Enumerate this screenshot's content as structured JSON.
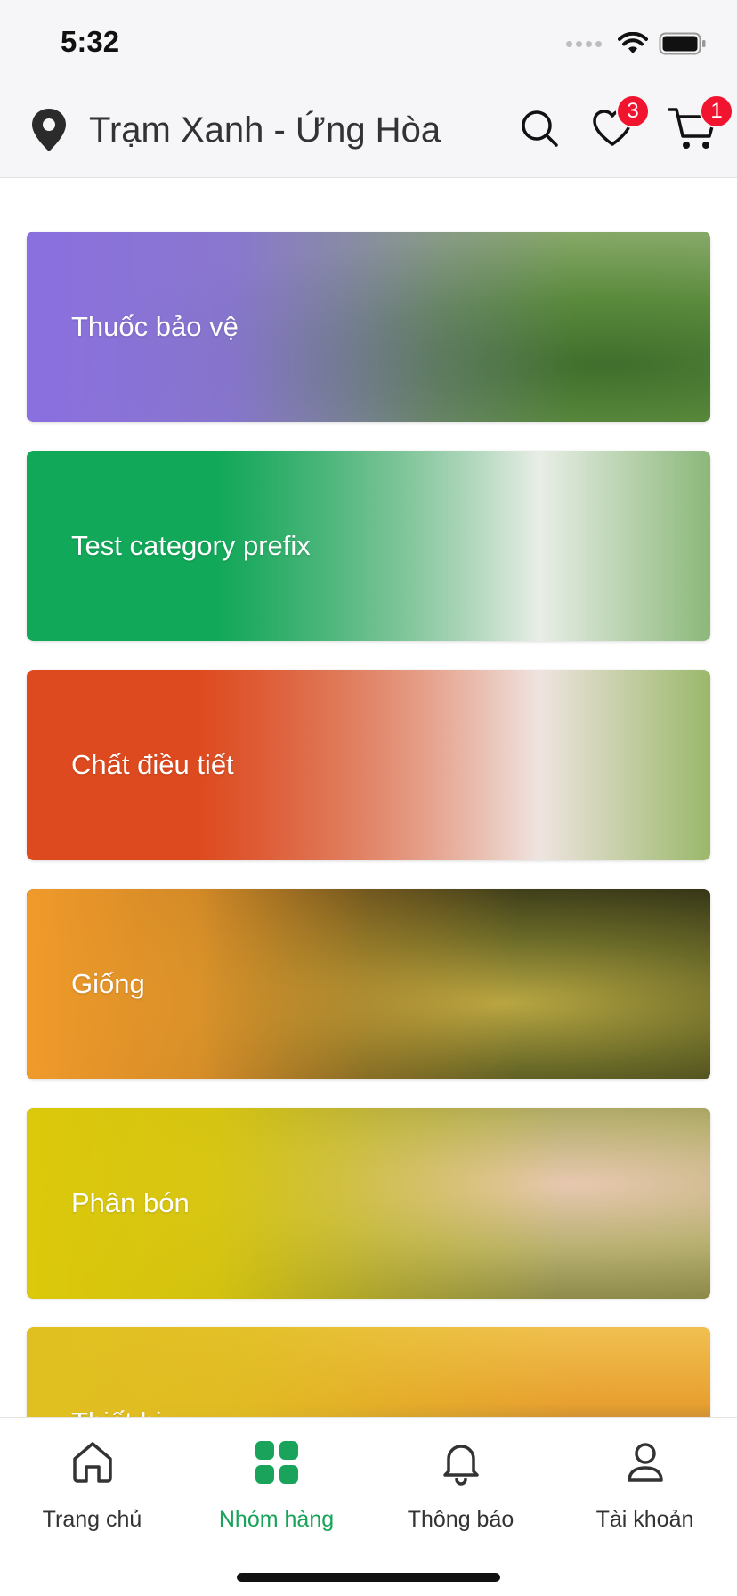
{
  "status_bar": {
    "time": "5:32"
  },
  "header": {
    "location": "Trạm Xanh - Ứng Hòa",
    "wishlist_count": "3",
    "cart_count": "1"
  },
  "categories": [
    {
      "label": "Thuốc bảo vệ",
      "color": "#8a6fe0"
    },
    {
      "label": "Test category prefix",
      "color": "#12a85a"
    },
    {
      "label": "Chất điều tiết",
      "color": "#de4a1f"
    },
    {
      "label": "Giống",
      "color": "#f09a2a"
    },
    {
      "label": "Phân bón",
      "color": "#dcc90b"
    },
    {
      "label": "Thiết bị",
      "color": "#e0c020"
    }
  ],
  "bottom_nav": {
    "items": [
      {
        "label": "Trang chủ",
        "active": false
      },
      {
        "label": "Nhóm hàng",
        "active": true
      },
      {
        "label": "Thông báo",
        "active": false
      },
      {
        "label": "Tài khoản",
        "active": false
      }
    ],
    "active_color": "#1aa35a"
  }
}
